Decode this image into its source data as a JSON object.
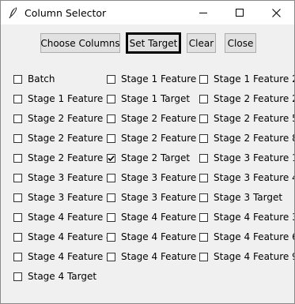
{
  "window": {
    "title": "Column Selector",
    "icons": {
      "app": "feather-icon",
      "minimize": "minimize-icon",
      "maximize": "maximize-icon",
      "close": "close-icon"
    }
  },
  "toolbar": {
    "choose_columns_label": "Choose Columns",
    "set_target_label": "Set Target",
    "clear_label": "Clear",
    "close_label": "Close"
  },
  "columns": [
    {
      "label": "Batch",
      "checked": false
    },
    {
      "label": "Stage 1 Feature 1",
      "checked": false
    },
    {
      "label": "Stage 1 Feature 2",
      "checked": false
    },
    {
      "label": "Stage 1 Feature 3",
      "checked": false
    },
    {
      "label": "Stage 1 Target",
      "checked": false
    },
    {
      "label": "Stage 2 Feature 2",
      "checked": false
    },
    {
      "label": "Stage 2 Feature 3",
      "checked": false
    },
    {
      "label": "Stage 2 Feature 4",
      "checked": false
    },
    {
      "label": "Stage 2 Feature 5",
      "checked": false
    },
    {
      "label": "Stage 2 Feature 6",
      "checked": false
    },
    {
      "label": "Stage 2 Feature 7",
      "checked": false
    },
    {
      "label": "Stage 2 Feature 8",
      "checked": false
    },
    {
      "label": "Stage 2 Feature 1",
      "checked": false
    },
    {
      "label": "Stage 2 Target",
      "checked": true
    },
    {
      "label": "Stage 3 Feature 1",
      "checked": false
    },
    {
      "label": "Stage 3 Feature 2",
      "checked": false
    },
    {
      "label": "Stage 3 Feature 3",
      "checked": false
    },
    {
      "label": "Stage 3 Feature 4",
      "checked": false
    },
    {
      "label": "Stage 3 Feature 5",
      "checked": false
    },
    {
      "label": "Stage 3 Feature 6",
      "checked": false
    },
    {
      "label": "Stage 3 Target",
      "checked": false
    },
    {
      "label": "Stage 4 Feature 1",
      "checked": false
    },
    {
      "label": "Stage 4 Feature 2",
      "checked": false
    },
    {
      "label": "Stage 4 Feature 3",
      "checked": false
    },
    {
      "label": "Stage 4 Feature 4",
      "checked": false
    },
    {
      "label": "Stage 4 Feature 5",
      "checked": false
    },
    {
      "label": "Stage 4 Feature 6",
      "checked": false
    },
    {
      "label": "Stage 4 Feature 7",
      "checked": false
    },
    {
      "label": "Stage 4 Feature 8",
      "checked": false
    },
    {
      "label": "Stage 4 Feature 9",
      "checked": false
    },
    {
      "label": "Stage 4 Target",
      "checked": false
    }
  ]
}
